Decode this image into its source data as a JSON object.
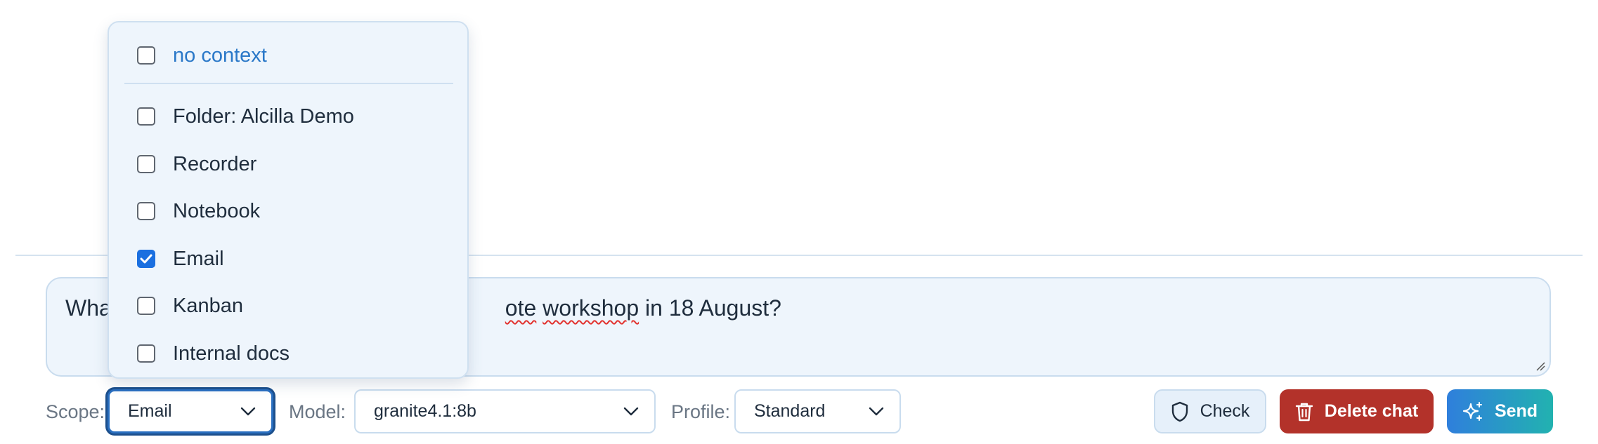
{
  "composer": {
    "text_lead": "Wha",
    "text_word_1": "ote",
    "text_space": " ",
    "text_word_2": "workshop",
    "text_tail": " in 18 August?"
  },
  "controls": {
    "scope_label": "Scope:",
    "scope_value": "Email",
    "model_label": "Model:",
    "model_value": "granite4.1:8b",
    "profile_label": "Profile:",
    "profile_value": "Standard"
  },
  "buttons": {
    "check": "Check",
    "delete": "Delete chat",
    "send": "Send"
  },
  "scope_menu": {
    "options": [
      {
        "label": "no context",
        "checked": false
      },
      {
        "label": "Folder: Alcilla Demo",
        "checked": false
      },
      {
        "label": "Recorder",
        "checked": false
      },
      {
        "label": "Notebook",
        "checked": false
      },
      {
        "label": "Email",
        "checked": true
      },
      {
        "label": "Kanban",
        "checked": false
      },
      {
        "label": "Internal docs",
        "checked": false
      }
    ]
  },
  "colors": {
    "accent": "#2a6fc0",
    "danger": "#b3322a",
    "send_gradient_start": "#2f7fdc",
    "send_gradient_end": "#22b2b0",
    "checkbox_checked": "#1a6fe0"
  },
  "icons": {
    "check": "shield-icon",
    "delete": "trash-icon",
    "send": "sparkles-icon",
    "select": "chevron-down-icon"
  }
}
